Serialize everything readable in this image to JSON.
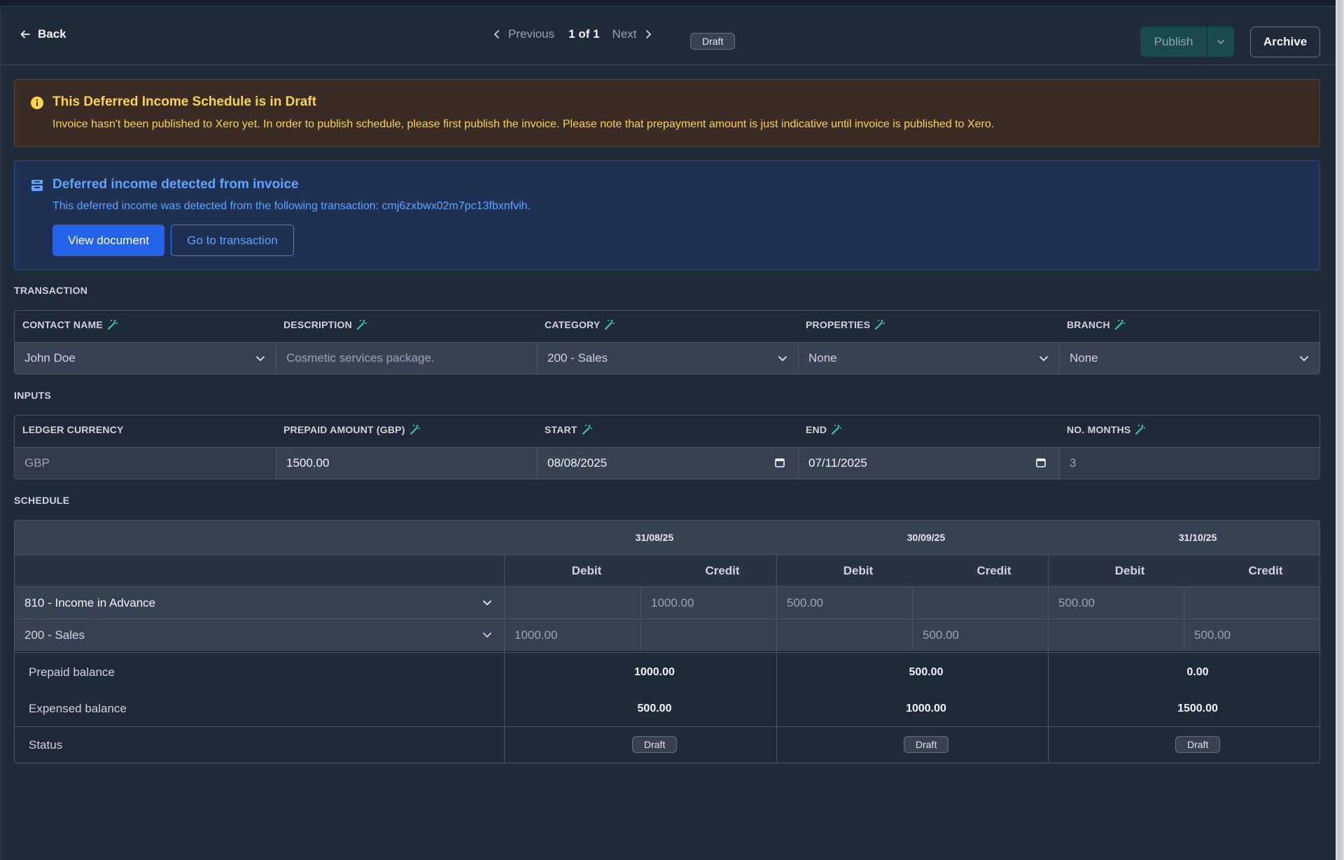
{
  "header": {
    "back_label": "Back",
    "prev_label": "Previous",
    "page_count": "1 of 1",
    "next_label": "Next",
    "status": "Draft",
    "publish_label": "Publish",
    "archive_label": "Archive"
  },
  "warning": {
    "title": "This Deferred Income Schedule is in Draft",
    "message": "Invoice hasn't been published to Xero yet. In order to publish schedule, please first publish the invoice. Please note that prepayment amount is just indicative until invoice is published to Xero."
  },
  "info": {
    "title": "Deferred income detected from invoice",
    "message": "This deferred income was detected from the following transaction: cmj6zxbwx02m7pc13fbxnfvih.",
    "view_document_label": "View document",
    "go_to_transaction_label": "Go to transaction"
  },
  "transaction": {
    "section_label": "TRANSACTION",
    "fields": [
      {
        "label": "CONTACT NAME",
        "value": "John Doe"
      },
      {
        "label": "DESCRIPTION",
        "value": "Cosmetic services package."
      },
      {
        "label": "CATEGORY",
        "value": "200 - Sales"
      },
      {
        "label": "PROPERTIES",
        "value": "None"
      },
      {
        "label": "BRANCH",
        "value": "None"
      }
    ]
  },
  "inputs": {
    "section_label": "INPUTS",
    "fields": [
      {
        "label": "LEDGER CURRENCY",
        "value": "GBP"
      },
      {
        "label": "PREPAID AMOUNT (GBP)",
        "value": "1500.00"
      },
      {
        "label": "START",
        "value": "08/08/2025"
      },
      {
        "label": "END",
        "value": "07/11/2025"
      },
      {
        "label": "NO. MONTHS",
        "value": "3"
      }
    ]
  },
  "schedule": {
    "section_label": "SCHEDULE",
    "debit_label": "Debit",
    "credit_label": "Credit",
    "periods": [
      "31/08/25",
      "30/09/25",
      "31/10/25"
    ],
    "rows": [
      {
        "account": "810 - Income in Advance",
        "cells": [
          "",
          "1000.00",
          "500.00",
          "",
          "500.00",
          ""
        ]
      },
      {
        "account": "200 - Sales",
        "cells": [
          "1000.00",
          "",
          "",
          "500.00",
          "",
          "500.00"
        ]
      }
    ],
    "prepaid_label": "Prepaid balance",
    "prepaid_values": [
      "1000.00",
      "500.00",
      "0.00"
    ],
    "expensed_label": "Expensed balance",
    "expensed_values": [
      "500.00",
      "1000.00",
      "1500.00"
    ],
    "status_label": "Status",
    "status_values": [
      "Draft",
      "Draft",
      "Draft"
    ]
  },
  "colors": {
    "background": "#1f2937",
    "warning_text": "#fcd34d",
    "info_text": "#60a5fa",
    "primary_button": "#2563eb",
    "publish_button": "#1b4a4c"
  }
}
